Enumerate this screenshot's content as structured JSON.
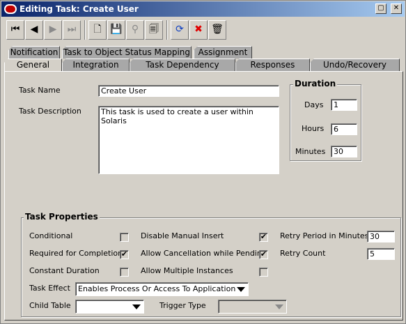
{
  "window": {
    "title": "Editing Task: Create User"
  },
  "toolbar": {
    "buttons": [
      {
        "name": "first-record-icon",
        "glyph": "⏮",
        "enabled": true
      },
      {
        "name": "previous-record-icon",
        "glyph": "◀",
        "enabled": true
      },
      {
        "name": "next-record-icon",
        "glyph": "▶",
        "enabled": false
      },
      {
        "name": "last-record-icon",
        "glyph": "⏭",
        "enabled": false
      },
      {
        "name": "new-icon",
        "glyph": "🗋",
        "enabled": true
      },
      {
        "name": "save-icon",
        "glyph": "💾",
        "enabled": true
      },
      {
        "name": "find-icon",
        "glyph": "🔭",
        "enabled": false
      },
      {
        "name": "query-icon",
        "glyph": "🗐",
        "enabled": true
      },
      {
        "name": "refresh-icon",
        "glyph": "⟳",
        "enabled": true
      },
      {
        "name": "delete-icon",
        "glyph": "✖",
        "enabled": true
      },
      {
        "name": "trash-icon",
        "glyph": "🗑",
        "enabled": true
      }
    ]
  },
  "tabs": {
    "back_row": [
      "Notification",
      "Task to Object Status Mapping",
      "Assignment"
    ],
    "front_row": [
      "General",
      "Integration",
      "Task Dependency",
      "Responses",
      "Undo/Recovery"
    ],
    "active": "General"
  },
  "general": {
    "task_name_label": "Task Name",
    "task_name_value": "Create User",
    "task_description_label": "Task Description",
    "task_description_value": "This task is used to create a user within Solaris"
  },
  "duration": {
    "title": "Duration",
    "days_label": "Days",
    "days_value": "1",
    "hours_label": "Hours",
    "hours_value": "6",
    "minutes_label": "Minutes",
    "minutes_value": "30"
  },
  "task_properties": {
    "title": "Task Properties",
    "conditional_label": "Conditional",
    "conditional_checked": false,
    "required_label": "Required for Completion",
    "required_checked": true,
    "constant_label": "Constant Duration",
    "constant_checked": false,
    "disable_manual_label": "Disable Manual Insert",
    "disable_manual_checked": true,
    "allow_cancel_label": "Allow Cancellation while Pending",
    "allow_cancel_checked": true,
    "allow_multiple_label": "Allow Multiple Instances",
    "allow_multiple_checked": false,
    "retry_period_label": "Retry Period in Minutes",
    "retry_period_value": "30",
    "retry_count_label": "Retry Count",
    "retry_count_value": "5",
    "task_effect_label": "Task Effect",
    "task_effect_value": "Enables Process Or Access To Application",
    "child_table_label": "Child Table",
    "child_table_value": "",
    "trigger_type_label": "Trigger Type",
    "trigger_type_value": ""
  }
}
